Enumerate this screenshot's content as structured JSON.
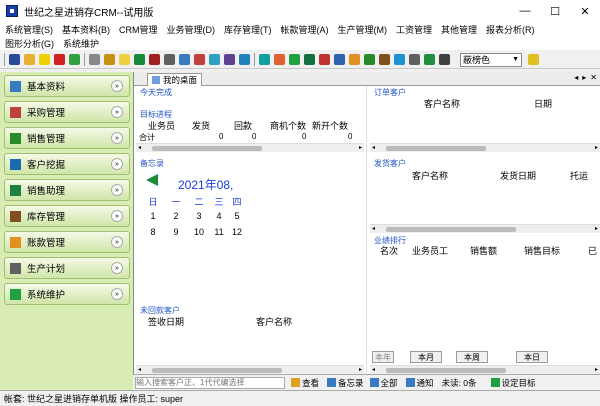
{
  "window": {
    "title": "世纪之星进销存CRM--试用版",
    "min": "—",
    "max": "☐",
    "close": "✕"
  },
  "menu": {
    "row1": [
      "系统管理(S)",
      "基本资料(B)",
      "CRM管理",
      "业务管理(D)",
      "库存管理(T)",
      "帐款管理(A)",
      "生产管理(M)",
      "工资管理",
      "其他管理",
      "报表分析(R)"
    ],
    "row2": [
      "图形分析(G)",
      "系统维护"
    ]
  },
  "toolbar": {
    "skin_label": "蔽榜色",
    "colors": [
      "#2a4a9a",
      "#e8b030",
      "#f0d000",
      "#d02020",
      "#30a040",
      "#888",
      "#c89010",
      "#f0d040",
      "#1a8a3a",
      "#a02020",
      "#606060",
      "#3a7ac0",
      "#c04040",
      "#30a0c0",
      "#604090",
      "#2080c0",
      "#10a0a0",
      "#e06030",
      "#20a040",
      "#107040",
      "#c03030",
      "#3060b0",
      "#e09020",
      "#2a8a2a",
      "#805020",
      "#2090d0",
      "#606060",
      "#209040",
      "#404040"
    ]
  },
  "sidebar": {
    "items": [
      {
        "label": "基本资料",
        "icon_name": "folder-icon",
        "color": "#3a7ac0"
      },
      {
        "label": "采购管理",
        "icon_name": "purchase-icon",
        "color": "#c04040"
      },
      {
        "label": "销售管理",
        "icon_name": "sales-icon",
        "color": "#2a8a2a"
      },
      {
        "label": "客户挖掘",
        "icon_name": "customer-icon",
        "color": "#1a6ab0"
      },
      {
        "label": "销售助理",
        "icon_name": "assistant-icon",
        "color": "#208040"
      },
      {
        "label": "库存管理",
        "icon_name": "warehouse-icon",
        "color": "#805020"
      },
      {
        "label": "账款管理",
        "icon_name": "account-icon",
        "color": "#e09020"
      },
      {
        "label": "生产计划",
        "icon_name": "production-icon",
        "color": "#606060"
      },
      {
        "label": "系统维护",
        "icon_name": "maintenance-icon",
        "color": "#20a040"
      }
    ]
  },
  "workspace": {
    "tab_label": "我的桌面",
    "tab_nav": [
      "◂",
      "▸",
      "✕"
    ],
    "sections": {
      "todo_title": "今天完成",
      "target_title": "目标进程",
      "target_cols": [
        "业务员",
        "发货",
        "回款",
        "商机个数",
        "新开个数"
      ],
      "target_total_label": "合计",
      "target_totals": [
        "0",
        "0",
        "0",
        "0"
      ],
      "memo_title": "备忘录",
      "calendar": {
        "month": "2021年08,",
        "week_headers": [
          "日",
          "一",
          "二",
          "三",
          "四"
        ],
        "rows": [
          [
            "",
            "",
            "",
            "",
            ""
          ],
          [
            "1",
            "2",
            "3",
            "4",
            "5"
          ],
          [
            "8",
            "9",
            "10",
            "11",
            "12"
          ]
        ]
      },
      "return_title": "未回款客户",
      "return_cols": [
        "签收日期",
        "客户名称"
      ],
      "order_title": "订单客户",
      "order_cols": [
        "客户名称",
        "日期"
      ],
      "ship_title": "发货客户",
      "ship_cols": [
        "客户名称",
        "发货日期",
        "托运"
      ],
      "rank_title": "业绩排行",
      "rank_cols": [
        "名次",
        "业务员工",
        "销售额",
        "销售目标",
        "已"
      ],
      "rank_buttons": [
        "本年",
        "本月",
        "本周",
        "本日"
      ]
    }
  },
  "bottom": {
    "search_placeholder": "输入搜索客户正、1代代编选择",
    "view": "查看",
    "memo": "备忘录",
    "all": "全部",
    "notify": "通知",
    "unread": "未读: 0条",
    "target": "设定目标"
  },
  "status": {
    "text": "帐套: 世纪之星进销存单机版 操作员工: super"
  }
}
